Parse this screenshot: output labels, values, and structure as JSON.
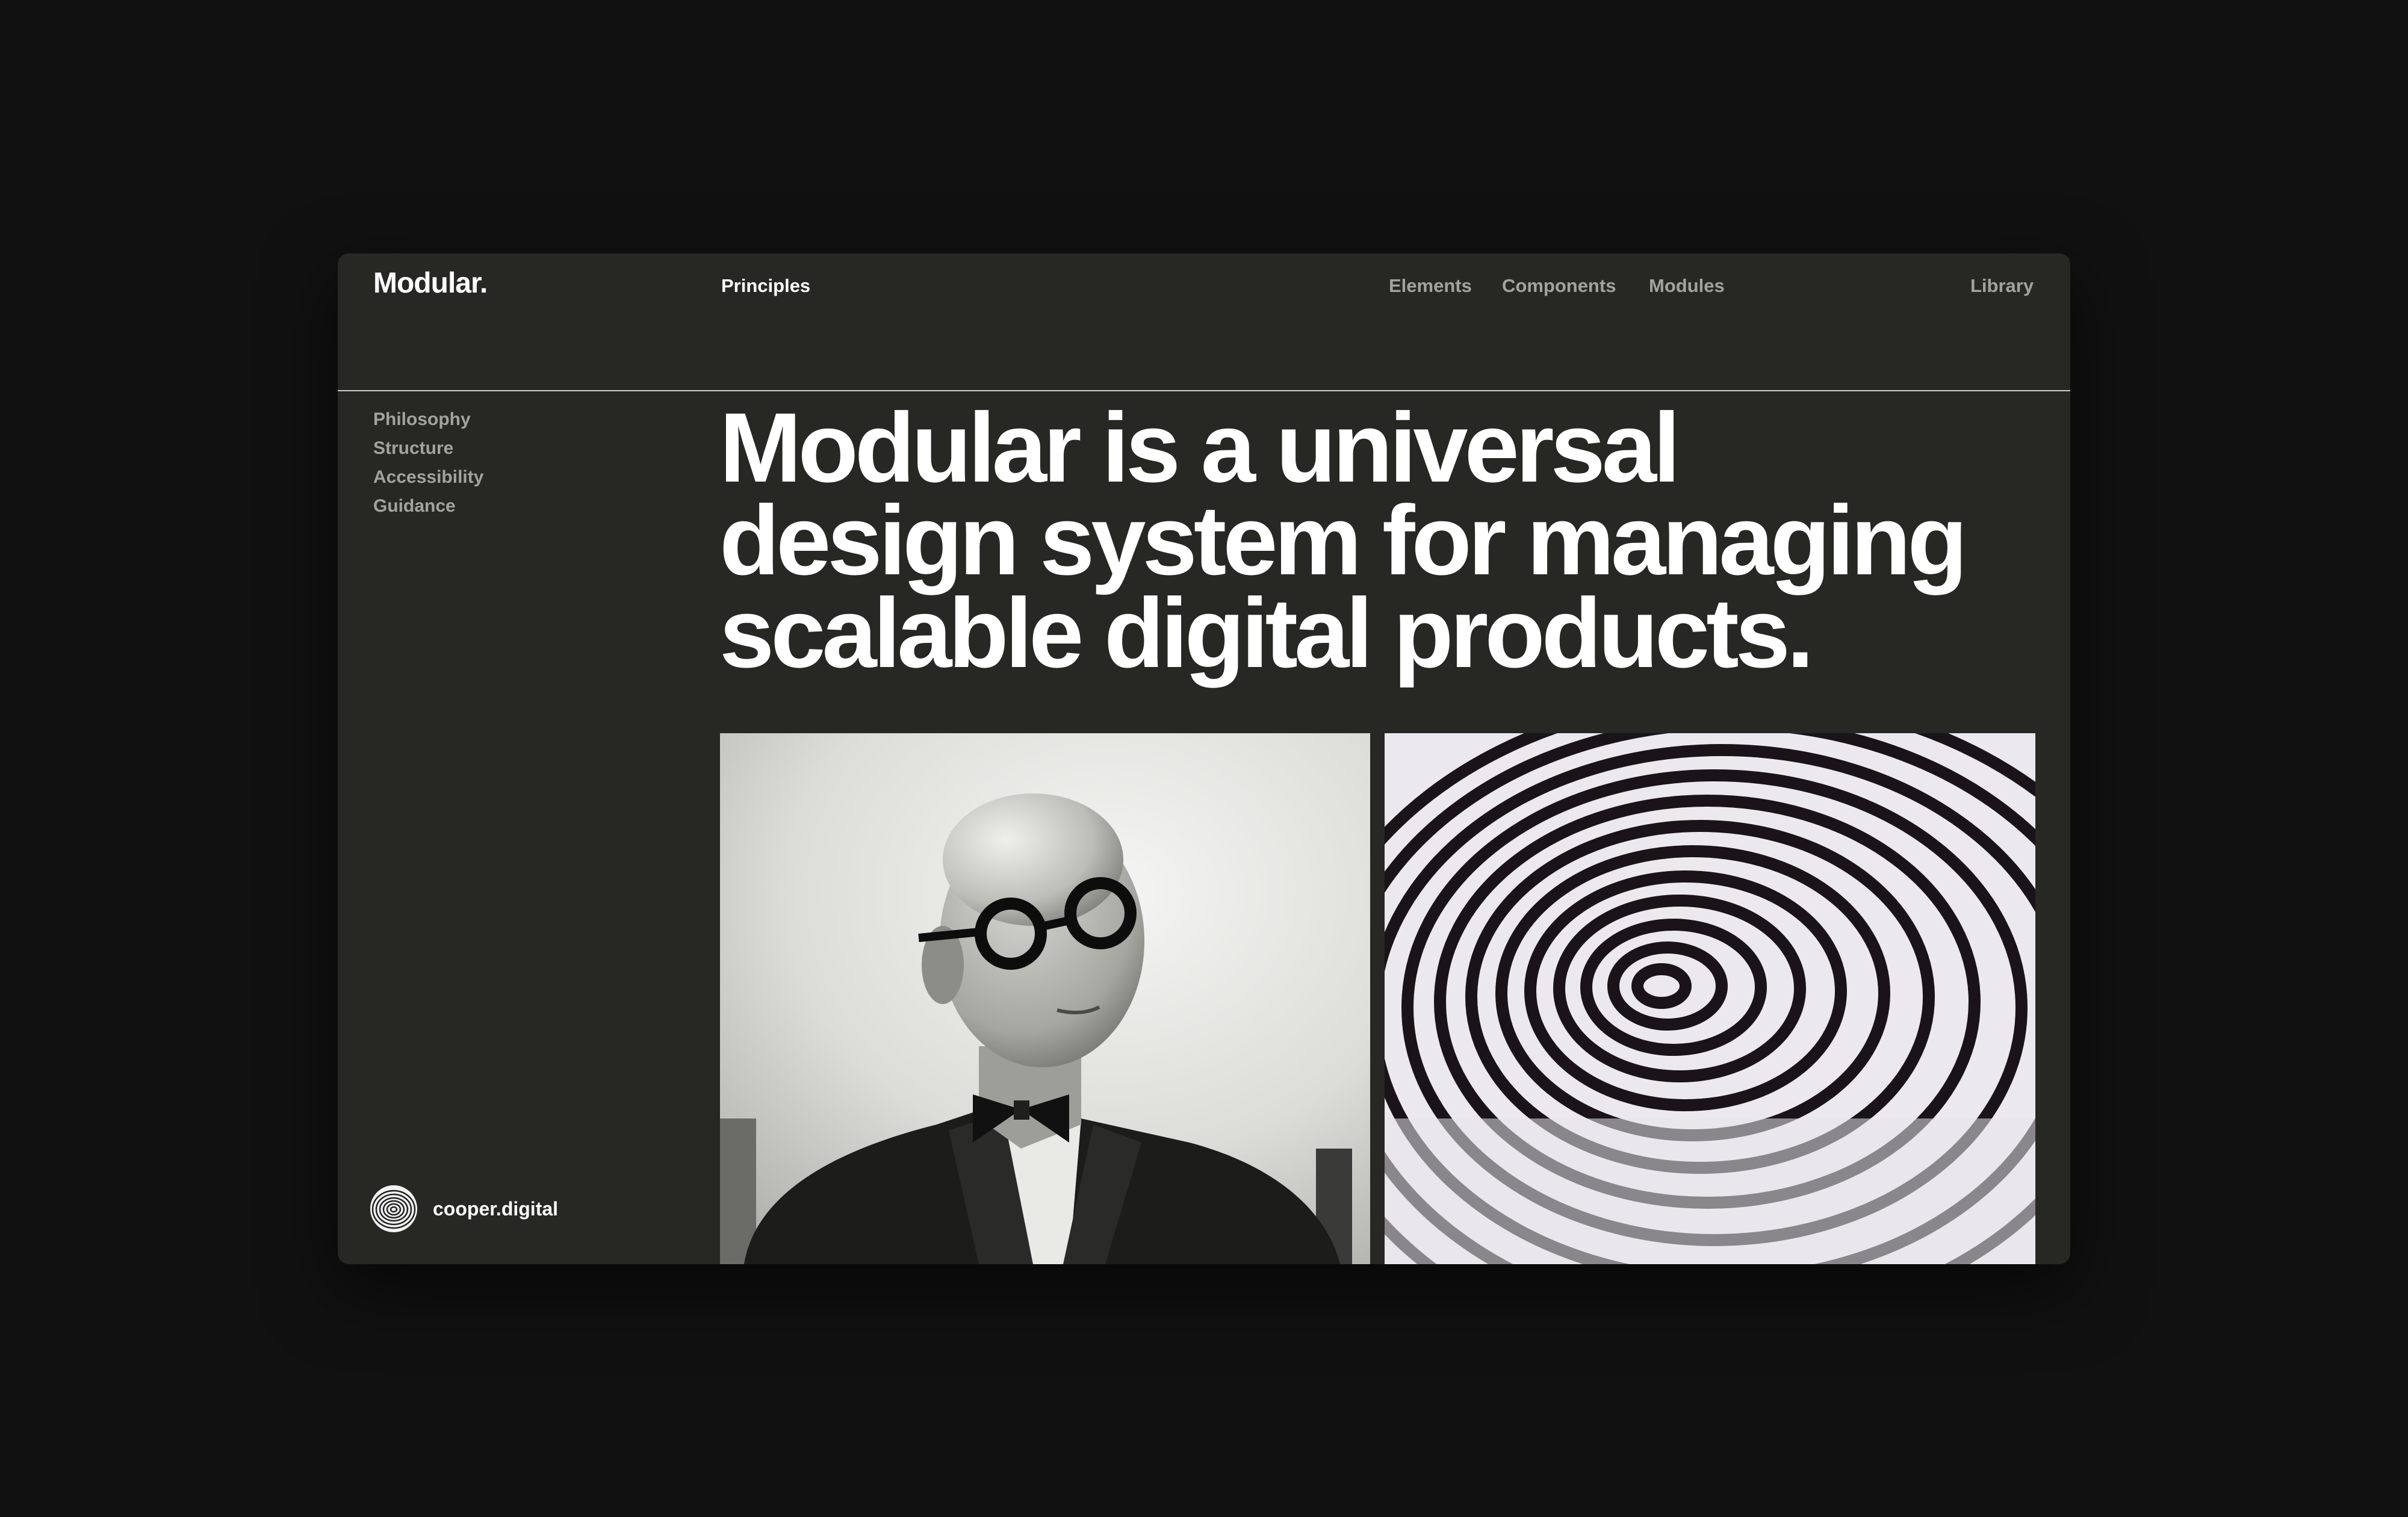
{
  "app": {
    "brand": "Modular."
  },
  "nav": {
    "principles": "Principles",
    "elements": "Elements",
    "components": "Components",
    "modules": "Modules",
    "library": "Library"
  },
  "sidebar": {
    "items": [
      {
        "label": "Philosophy"
      },
      {
        "label": "Structure"
      },
      {
        "label": "Accessibility"
      },
      {
        "label": "Guidance"
      }
    ]
  },
  "hero": {
    "line1": "Modular is a universal",
    "line2": "design system for managing",
    "line3": "scalable digital products."
  },
  "images": {
    "left": "portrait-photo",
    "right": "fingerprint-photo"
  },
  "footer": {
    "brand": "cooper.digital",
    "logo_icon": "fingerprint-icon"
  },
  "colors": {
    "background": "#111111",
    "window": "#272724",
    "text_primary": "#ffffff",
    "text_muted": "#a3a39e"
  }
}
